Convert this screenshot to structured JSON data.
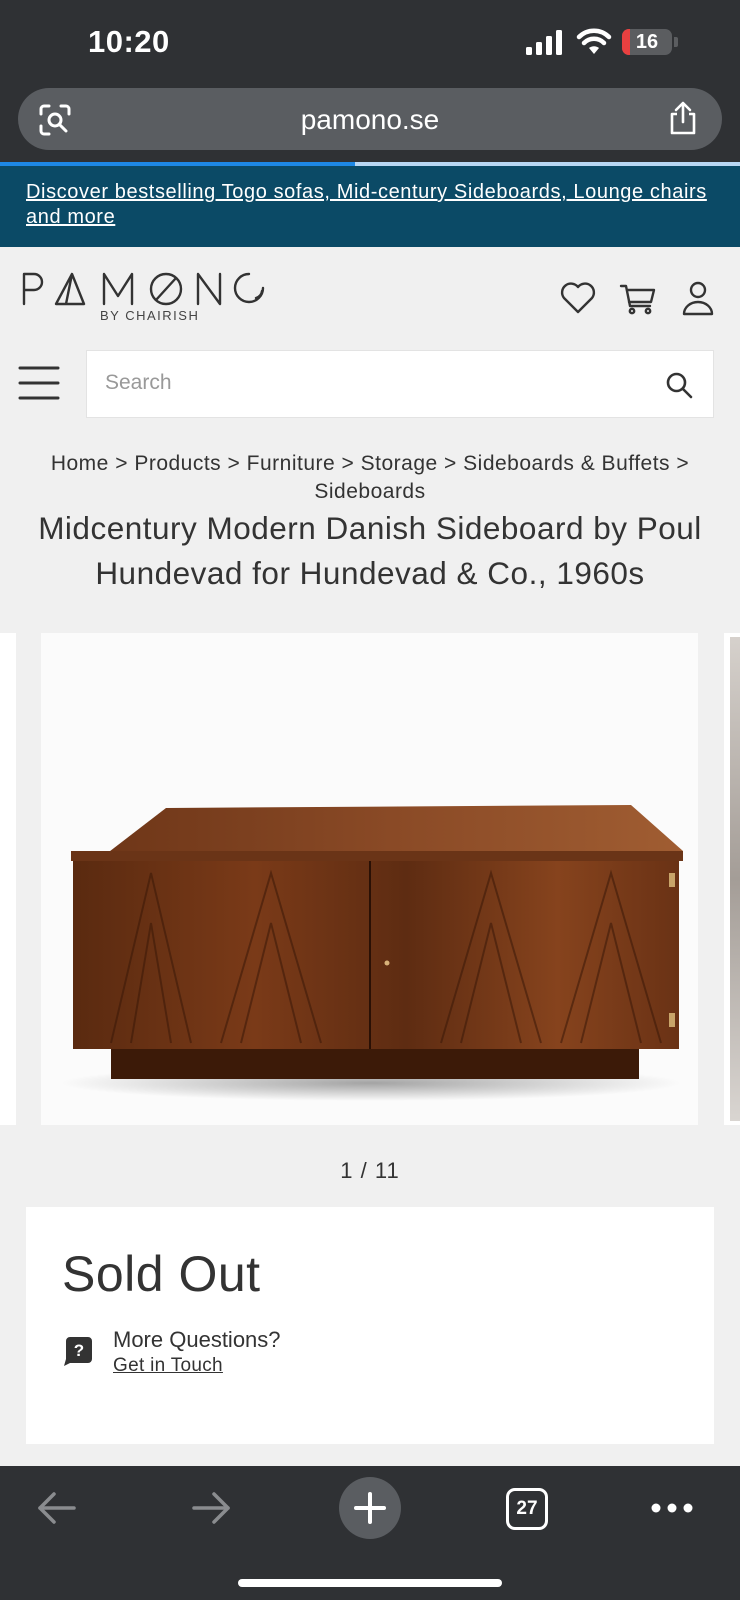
{
  "status": {
    "time": "10:20",
    "battery": "16",
    "battery_level": 0.16
  },
  "browser": {
    "url": "pamono.se",
    "load_progress": 0.48
  },
  "promo": {
    "text": "Discover bestselling Togo sofas, Mid-century Sideboards, Lounge chairs and more"
  },
  "header": {
    "logo_text": "PAMONO",
    "logo_sub": "BY CHAIRISH",
    "icons": [
      "heart-icon",
      "cart-icon",
      "user-icon"
    ]
  },
  "search": {
    "placeholder": "Search",
    "value": ""
  },
  "breadcrumb": {
    "items": [
      "Home",
      "Products",
      "Furniture",
      "Storage",
      "Sideboards & Buffets",
      "Sideboards"
    ],
    "separator": ">"
  },
  "product": {
    "title": "Midcentury Modern Danish Sideboard by Poul Hundevad for Hundevad & Co., 1960s",
    "image_counter": "1 / 11",
    "status": "Sold Out",
    "questions_label": "More Questions?",
    "contact_link": "Get in Touch"
  },
  "toolbar": {
    "tab_count": "27"
  },
  "colors": {
    "chrome": "#2f3134",
    "promo_bg": "#0b4a66",
    "page_bg": "#f0f0f0",
    "accent_progress": "#1e88e5",
    "battery_low": "#e94040"
  }
}
